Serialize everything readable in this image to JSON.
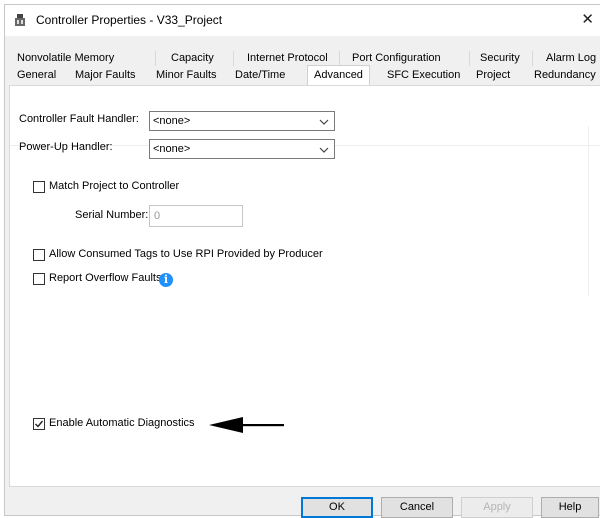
{
  "window": {
    "title": "Controller Properties - V33_Project",
    "close_glyph": "✕"
  },
  "tabs_row1": [
    {
      "label": "Nonvolatile Memory"
    },
    {
      "label": "Capacity"
    },
    {
      "label": "Internet Protocol"
    },
    {
      "label": "Port Configuration"
    },
    {
      "label": "Security"
    },
    {
      "label": "Alarm Log"
    }
  ],
  "tabs_row2": [
    {
      "label": "General"
    },
    {
      "label": "Major Faults"
    },
    {
      "label": "Minor Faults"
    },
    {
      "label": "Date/Time"
    },
    {
      "label": "Advanced",
      "active": true
    },
    {
      "label": "SFC Execution"
    },
    {
      "label": "Project"
    },
    {
      "label": "Redundancy"
    }
  ],
  "advanced": {
    "fault_handler_label": "Controller Fault Handler:",
    "fault_handler_value": "<none>",
    "powerup_handler_label": "Power-Up Handler:",
    "powerup_handler_value": "<none>",
    "match_project_label": "Match Project to Controller",
    "match_project_checked": false,
    "serial_number_label": "Serial Number:",
    "serial_number_value": "0",
    "allow_consumed_label": "Allow Consumed Tags to Use RPI Provided by Producer",
    "allow_consumed_checked": false,
    "report_overflow_label": "Report Overflow Faults",
    "report_overflow_checked": false,
    "enable_diagnostics_label": "Enable Automatic Diagnostics",
    "enable_diagnostics_checked": true
  },
  "buttons": {
    "ok": "OK",
    "cancel": "Cancel",
    "apply": "Apply",
    "help": "Help"
  },
  "icons": {
    "app": "controller-properties-icon",
    "info": "info-icon",
    "info_glyph": "i",
    "arrow": "annotation-arrow-icon"
  },
  "colors": {
    "accent": "#0078d7",
    "info": "#1e90ff"
  }
}
